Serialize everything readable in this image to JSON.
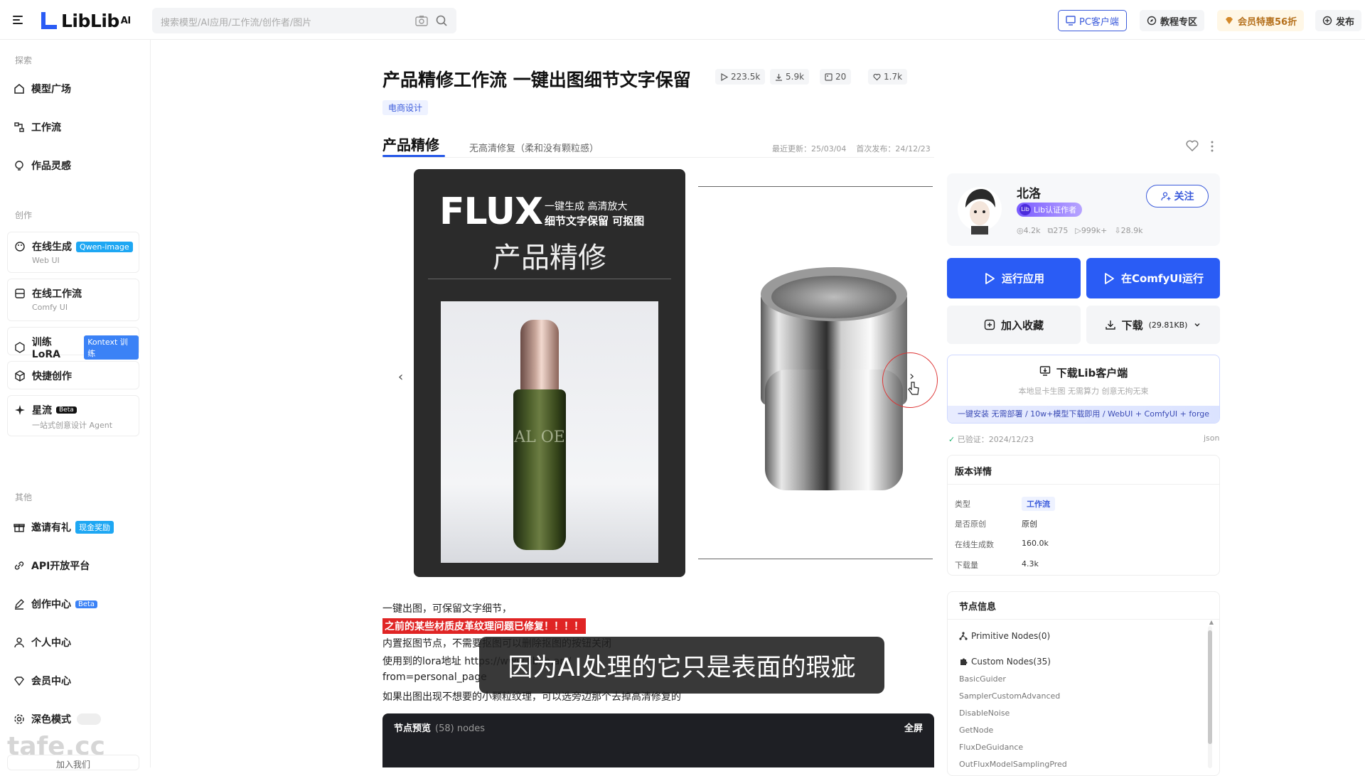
{
  "app": {
    "logo_text": "LibLib",
    "logo_sup": "AI",
    "search_placeholder": "搜索模型/AI应用/工作流/创作者/图片"
  },
  "topbar": {
    "pc_client": "PC客户端",
    "tutorial": "教程专区",
    "vip": "会员特惠56折",
    "publish": "发布"
  },
  "sidebar": {
    "section_explore": "探索",
    "section_create": "创作",
    "section_other": "其他",
    "explore_items": [
      "模型广场",
      "工作流",
      "作品灵感"
    ],
    "online_gen": {
      "label": "在线生成",
      "badge": "Qwen-image",
      "sub": "Web UI"
    },
    "online_workflow": {
      "label": "在线工作流",
      "sub": "Comfy UI"
    },
    "train_lora": {
      "label": "训练LoRA",
      "badge": "Kontext 训练"
    },
    "quick_create": {
      "label": "快捷创作"
    },
    "xingliu": {
      "label": "星流",
      "badge": "Beta",
      "sub": "一站式创意设计 Agent"
    },
    "invite": {
      "label": "邀请有礼",
      "badge": "现金奖励"
    },
    "api": {
      "label": "API开放平台"
    },
    "creator_center": {
      "label": "创作中心",
      "badge": "Beta"
    },
    "personal": {
      "label": "个人中心"
    },
    "vip_center": {
      "label": "会员中心"
    },
    "dark_mode": {
      "label": "深色模式"
    },
    "join_us": "加入我们",
    "watermark": "tafe.cc"
  },
  "main": {
    "title": "产品精修工作流 一键出图细节文字保留",
    "stats": {
      "runs": "223.5k",
      "downloads": "5.9k",
      "images": "20",
      "likes": "1.7k"
    },
    "tag": "电商设计",
    "tab_active": "产品精修",
    "tab_2": "无高清修复（柔和没有颗粒感）",
    "updated": "最近更新：25/03/04",
    "published": "首次发布：24/12/23",
    "poster": {
      "flux": "FLUX",
      "line1": "一键生成 高清放大",
      "line2": "细节文字保留 可抠图",
      "title": "产品精修",
      "bottle_text": "AL OE"
    },
    "description": {
      "line1": "一键出图，可保留文字细节，",
      "line2": "之前的某些材质皮革纹理问题已修复！！！！",
      "line3": "内置抠图节点，不需要抠图可以删除抠图的按钮关闭",
      "line4": "使用到的lora地址 https://www.liblib.art/",
      "line5": "from=personal_page",
      "line6": "如果出图出现不想要的小颗粒纹理，可以选旁边那个去掉高清修复的"
    },
    "subtitle": "因为AI处理的它只是表面的瑕疵",
    "preview": {
      "title": "节点预览",
      "count": "(58) nodes",
      "fullscreen": "全屏"
    }
  },
  "author": {
    "name": "北洛",
    "cert": "Lib认证作者",
    "follow": "关注",
    "stats": [
      "4.2k",
      "275",
      "999k+",
      "28.9k"
    ]
  },
  "actions": {
    "run_app": "运行应用",
    "run_comfy": "在ComfyUI运行",
    "favorite": "加入收藏",
    "download": "下载",
    "download_size": "(29.81KB)"
  },
  "client": {
    "title": "下载Lib客户端",
    "sub": "本地显卡生图 无需算力 创意无拘无束",
    "strip": "一键安装 无需部署 / 10w+模型下载即用 / WebUI + ComfyUI + forge"
  },
  "verified": {
    "label": "已验证",
    "date": "2024/12/23",
    "json": "json"
  },
  "version": {
    "title": "版本详情",
    "rows": [
      {
        "k": "类型",
        "v": "工作流"
      },
      {
        "k": "是否原创",
        "v": "原创"
      },
      {
        "k": "在线生成数",
        "v": "160.0k"
      },
      {
        "k": "下载量",
        "v": "4.3k"
      }
    ]
  },
  "nodes": {
    "title": "节点信息",
    "primitive": "Primitive Nodes(0)",
    "custom": "Custom Nodes(35)",
    "items": [
      "BasicGuider",
      "SamplerCustomAdvanced",
      "DisableNoise",
      "GetNode",
      "FluxDeGuidance",
      "OutFluxModelSamplingPred"
    ]
  },
  "colors": {
    "accent": "#2a5cf5",
    "badge_cyan": "#1ea7f3",
    "alert_red": "#e02424"
  }
}
